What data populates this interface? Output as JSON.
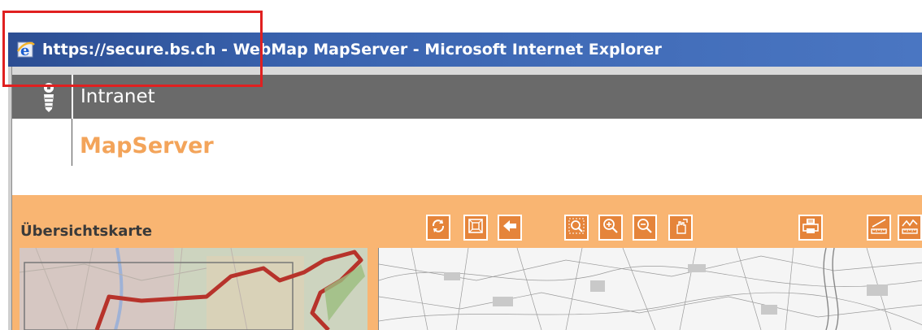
{
  "window": {
    "title": "https://secure.bs.ch - WebMap MapServer - Microsoft Internet Explorer",
    "icon": "ie-icon"
  },
  "header": {
    "org_label": "Intranet",
    "crest_icon": "basel-crest-icon"
  },
  "app": {
    "title": "MapServer"
  },
  "panel": {
    "overview_label": "Übersichtskarte"
  },
  "toolbar": {
    "buttons": [
      {
        "name": "refresh-icon"
      },
      {
        "name": "full-extent-icon"
      },
      {
        "name": "back-arrow-icon"
      },
      {
        "name": "zoom-box-icon"
      },
      {
        "name": "zoom-in-icon"
      },
      {
        "name": "zoom-out-icon"
      },
      {
        "name": "pan-hand-icon"
      },
      {
        "name": "print-icon"
      },
      {
        "name": "measure-distance-icon"
      },
      {
        "name": "measure-profile-icon"
      }
    ]
  },
  "colors": {
    "titlebar": "#2c4e93",
    "intranet_bar": "#6a6a6a",
    "accent_orange": "#f9b572",
    "button_orange": "#e5843a",
    "mapserver_title": "#f3a45a",
    "highlight_box": "#e02020"
  }
}
